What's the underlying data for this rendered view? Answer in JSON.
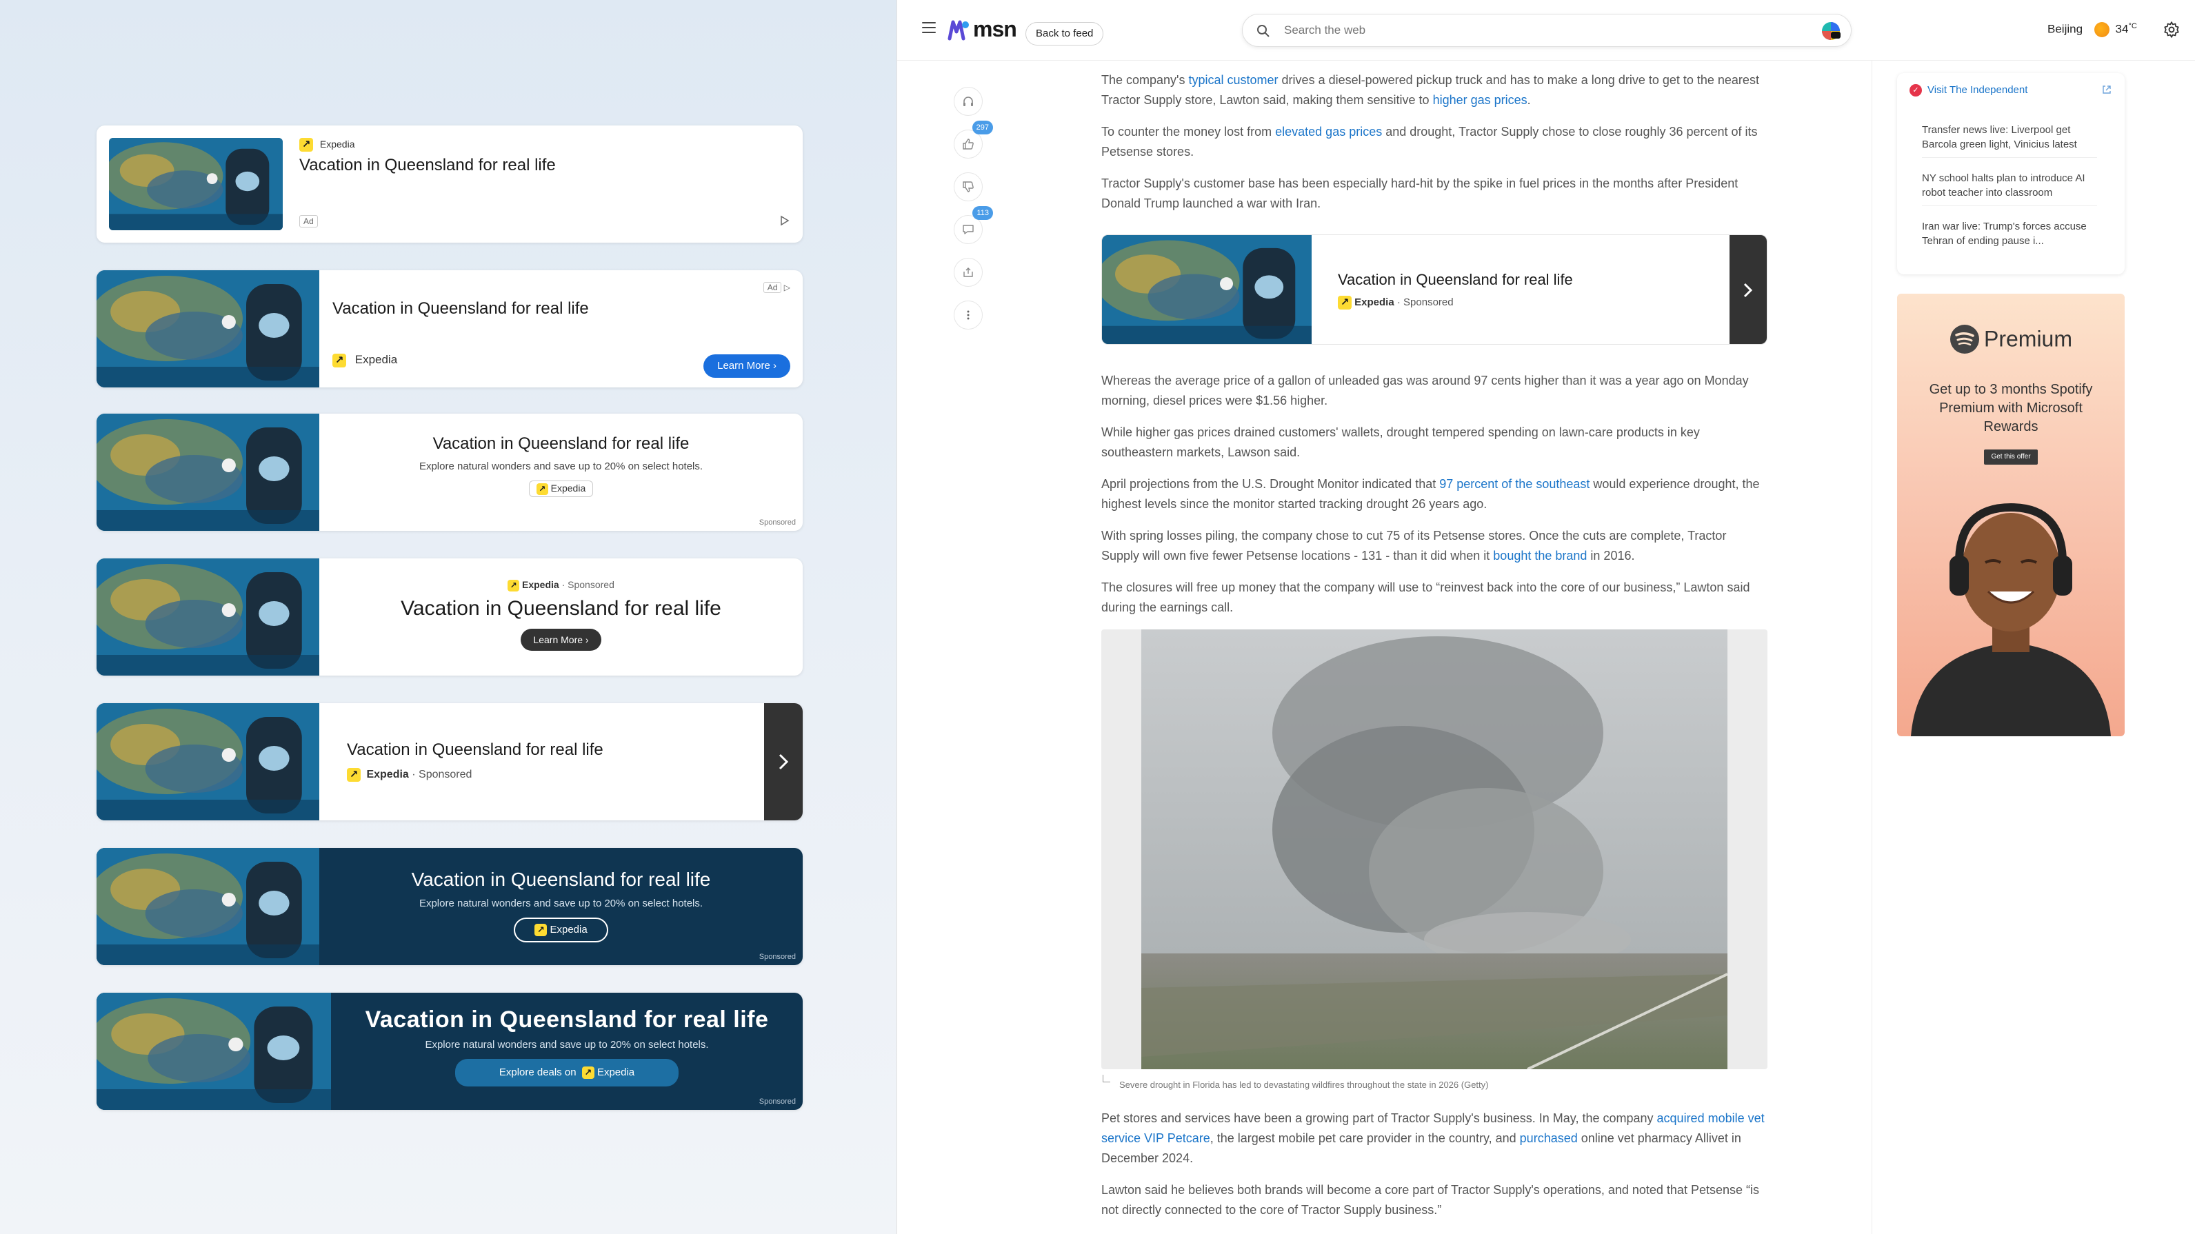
{
  "ads": {
    "brand": "Expedia",
    "title": "Vacation in Queensland for real life",
    "description": "Explore natural wonders and save up to 20% on select hotels.",
    "ad_badge": "Ad",
    "sponsored": "Sponsored",
    "brand_sponsored": "Expedia · Sponsored",
    "brand_sep_sponsored": "· Sponsored",
    "learn_more": "Learn More",
    "explore_deals": "Explore deals on",
    "colors": {
      "navy": "#0f3551",
      "brand_yellow": "#fddb32",
      "blue_button": "#1a6fde",
      "dark_arrow": "#333333"
    }
  },
  "msn": {
    "logo_text": "msn",
    "back_button": "Back to feed",
    "search_placeholder": "Search the web",
    "weather_city": "Beijing",
    "weather_temp": "34",
    "weather_unit": "°C",
    "icons": [
      "hamburger-icon",
      "search-icon",
      "copilot-icon",
      "weather-icon",
      "gear-icon",
      "headphones-icon",
      "thumbs-up-icon",
      "thumbs-down-icon",
      "comment-icon",
      "share-icon",
      "more-options-icon"
    ],
    "actions": {
      "likes": "297",
      "comments": "113"
    },
    "article": {
      "p1_a": "The company's ",
      "p1_link1": "typical customer",
      "p1_b": " drives a diesel-powered pickup truck and has to make a long drive to get to the nearest Tractor Supply store, Lawton said, making them sensitive to ",
      "p1_link2": "higher gas prices",
      "p1_c": ".",
      "p2_a": "To counter the money lost from ",
      "p2_link": "elevated gas prices",
      "p2_b": " and drought, Tractor Supply chose to close roughly 36 percent of its Petsense stores.",
      "p3": "Tractor Supply's customer base has been especially hard-hit by the spike in fuel prices in the months after President Donald Trump launched a war with Iran.",
      "p4": "Whereas the average price of a gallon of unleaded gas was around 97 cents higher than it was a year ago on Monday morning, diesel prices were $1.56 higher.",
      "p5": "While higher gas prices drained customers' wallets, drought tempered spending on lawn-care products in key southeastern markets, Lawson said.",
      "p6_a": "April projections from the U.S. Drought Monitor indicated that ",
      "p6_link": "97 percent of the southeast",
      "p6_b": " would experience drought, the highest levels since the monitor started tracking drought 26 years ago.",
      "p7_a": "With spring losses piling, the company chose to cut 75 of its Petsense stores. Once the cuts are complete, Tractor Supply will own five fewer Petsense locations - 131 - than it did when it ",
      "p7_link": "bought the brand",
      "p7_b": " in 2016.",
      "p8": "The closures will free up money that the company will use to “reinvest back into the core of our business,” Lawton said during the earnings call.",
      "caption": "Severe drought in Florida has led to devastating wildfires throughout the state in 2026 (Getty)",
      "p9_a": "Pet stores and services have been a growing part of Tractor Supply's business. In May, the company ",
      "p9_link1": "acquired mobile vet service VIP Petcare",
      "p9_b": ", the largest mobile pet care provider in the country, and ",
      "p9_link2": "purchased",
      "p9_c": " online vet pharmacy Allivet in December 2024.",
      "p10": "Lawton said he believes both brands will become a core part of Tractor Supply's operations, and noted that Petsense “is not directly connected to the core of Tractor Supply business.”"
    },
    "sidebar": {
      "more_from": "Visit The Independent",
      "items": [
        "Transfer news live: Liverpool get Barcola green light, Vinicius latest",
        "NY school halts plan to introduce AI robot teacher into classroom",
        "Iran war live: Trump's forces accuse Tehran of ending pause i..."
      ],
      "promo_brand": "Premium",
      "promo_text": "Get up to 3 months Spotify Premium with Microsoft Rewards",
      "promo_button": "Get this offer"
    }
  }
}
